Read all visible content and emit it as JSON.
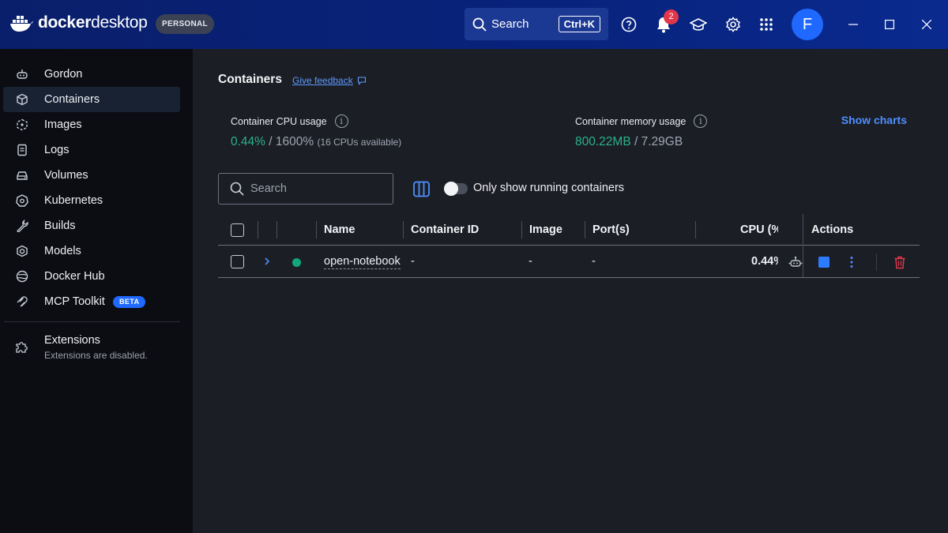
{
  "app": {
    "logo_text_bold": "docker",
    "logo_text_light": "desktop",
    "plan_badge": "PERSONAL",
    "search_label": "Search",
    "search_shortcut": "Ctrl+K",
    "notification_count": "2",
    "avatar_initial": "F"
  },
  "sidebar": {
    "items": [
      {
        "label": "Gordon",
        "icon": "gordon-icon"
      },
      {
        "label": "Containers",
        "icon": "container-icon",
        "active": true
      },
      {
        "label": "Images",
        "icon": "image-icon"
      },
      {
        "label": "Logs",
        "icon": "logs-icon"
      },
      {
        "label": "Volumes",
        "icon": "volume-icon"
      },
      {
        "label": "Kubernetes",
        "icon": "kubernetes-icon"
      },
      {
        "label": "Builds",
        "icon": "wrench-icon"
      },
      {
        "label": "Models",
        "icon": "models-icon"
      },
      {
        "label": "Docker Hub",
        "icon": "docker-hub-icon"
      },
      {
        "label": "MCP Toolkit",
        "icon": "mcp-icon",
        "badge": "BETA"
      }
    ],
    "extensions": {
      "title": "Extensions",
      "subtitle": "Extensions are disabled."
    }
  },
  "main": {
    "title": "Containers",
    "feedback_link": "Give feedback",
    "cpu": {
      "label": "Container CPU usage",
      "used": "0.44%",
      "sep": " / ",
      "total": "1600%",
      "note": "(16 CPUs available)"
    },
    "memory": {
      "label": "Container memory usage",
      "used": "800.22MB",
      "sep": " / ",
      "total": "7.29GB"
    },
    "show_charts": "Show charts",
    "search_placeholder": "Search",
    "running_toggle_label": "Only show running containers",
    "running_toggle_on": false,
    "table": {
      "headers": {
        "name": "Name",
        "container_id": "Container ID",
        "image": "Image",
        "ports": "Port(s)",
        "cpu": "CPU (%",
        "actions": "Actions"
      },
      "rows": [
        {
          "name": "open-notebook",
          "container_id": "-",
          "image": "-",
          "ports": "-",
          "cpu": "0.44%",
          "status": "running"
        }
      ]
    }
  },
  "colors": {
    "accent": "#1f69ff",
    "running": "#13a57e",
    "delete": "#e2364a",
    "topbar": "#08237d"
  }
}
